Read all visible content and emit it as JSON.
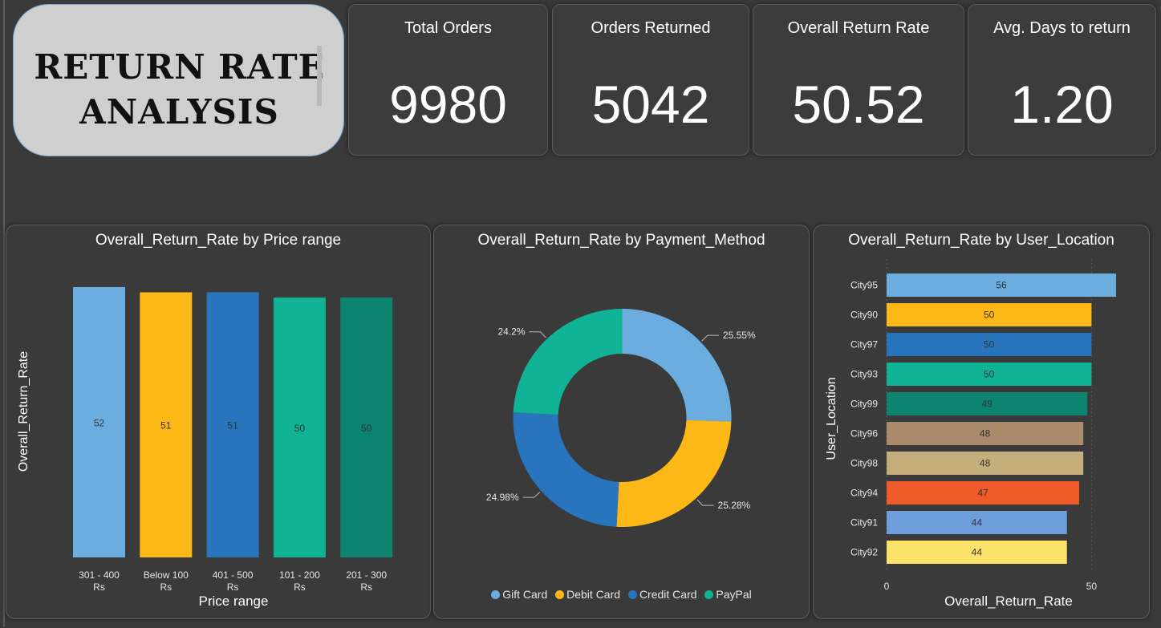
{
  "title": "RETURN RATE\nANALYSIS",
  "kpis": [
    {
      "label": "Total Orders",
      "value": "9980"
    },
    {
      "label": "Orders Returned",
      "value": "5042"
    },
    {
      "label": "Overall Return Rate",
      "value": "50.52"
    },
    {
      "label": "Avg. Days to return",
      "value": "1.20"
    }
  ],
  "chart_data": [
    {
      "type": "bar",
      "title": "Overall_Return_Rate by Price range",
      "xlabel": "Price range",
      "ylabel": "Overall_Return_Rate",
      "categories": [
        "301 - 400 Rs",
        "Below 100 Rs",
        "401 - 500 Rs",
        "101 - 200 Rs",
        "201 - 300 Rs"
      ],
      "values": [
        52,
        51,
        51,
        50,
        50
      ],
      "data_labels": [
        "52",
        "51",
        "51",
        "50",
        "50"
      ],
      "colors": [
        "#6cade0",
        "#fdb717",
        "#2875bd",
        "#10b396",
        "#0e8370"
      ],
      "ylim": [
        0,
        54
      ],
      "grid": false
    },
    {
      "type": "pie",
      "title": "Overall_Return_Rate by Payment_Method",
      "labels": [
        "Gift Card",
        "Debit Card",
        "Credit Card",
        "PayPal"
      ],
      "values": [
        25.55,
        25.28,
        24.98,
        24.2
      ],
      "data_labels": [
        "25.55%",
        "25.28%",
        "24.98%",
        "24.2%"
      ],
      "colors": [
        "#6cade0",
        "#fdb717",
        "#2875bd",
        "#10b396"
      ],
      "donut": true,
      "legend": "bottom"
    },
    {
      "type": "bar",
      "orientation": "horizontal",
      "title": "Overall_Return_Rate by User_Location",
      "xlabel": "Overall_Return_Rate",
      "ylabel": "User_Location",
      "categories": [
        "City95",
        "City90",
        "City97",
        "City93",
        "City99",
        "City96",
        "City98",
        "City94",
        "City91",
        "City92"
      ],
      "values": [
        56,
        50,
        50,
        50,
        49,
        48,
        48,
        47,
        44,
        44
      ],
      "data_labels": [
        "56",
        "50",
        "50",
        "50",
        "49",
        "48",
        "48",
        "47",
        "44",
        "44"
      ],
      "colors": [
        "#6cade0",
        "#fdb717",
        "#2875bd",
        "#10b396",
        "#0e8370",
        "#a98b6c",
        "#c4ae7b",
        "#f15a29",
        "#6f9edd",
        "#fee36b"
      ],
      "xticks": [
        "0",
        "50"
      ],
      "xlim": [
        0,
        56
      ],
      "grid": true
    }
  ]
}
